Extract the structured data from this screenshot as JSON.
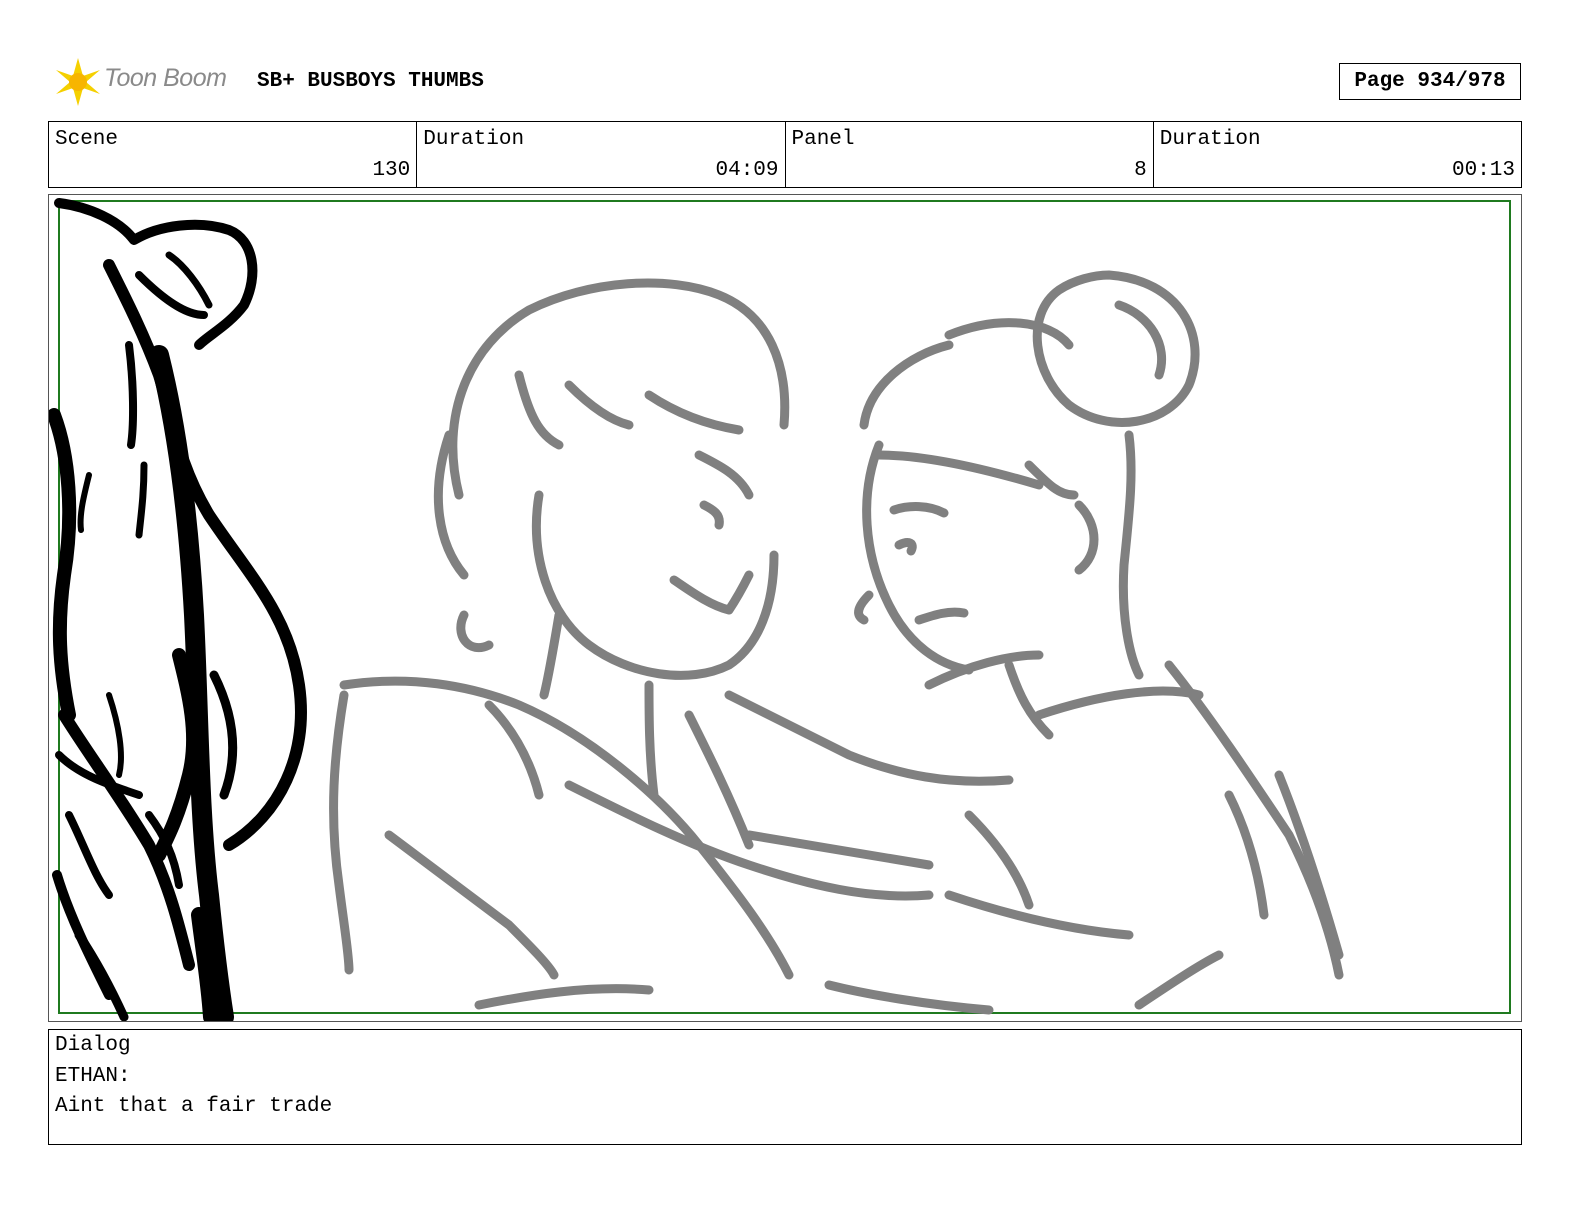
{
  "header": {
    "logo_text": "Toon Boom",
    "project_title": "SB+ BUSBOYS THUMBS",
    "page_label": "Page 934/978"
  },
  "info": {
    "scene_label": "Scene",
    "scene_value": "130",
    "scene_duration_label": "Duration",
    "scene_duration_value": "04:09",
    "panel_label": "Panel",
    "panel_value": "8",
    "panel_duration_label": "Duration",
    "panel_duration_value": "00:13"
  },
  "panel": {
    "frame_color": "#1f7a1f",
    "sketch_color": "#808080",
    "foreground_color": "#000000"
  },
  "dialog": {
    "label": "Dialog",
    "speaker": "ETHAN:",
    "line": "Aint that a fair trade"
  }
}
